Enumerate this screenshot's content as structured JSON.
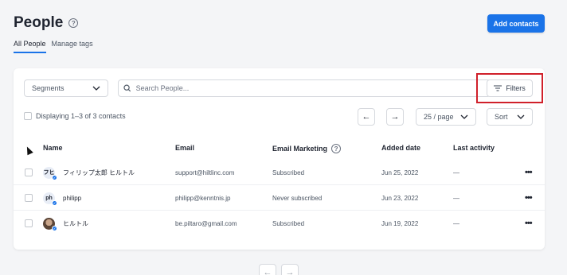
{
  "header": {
    "title": "People",
    "help_icon": "question-circle-icon",
    "add_button_label": "Add contacts",
    "accent": "#1a73e8"
  },
  "tabs": [
    {
      "label": "All People",
      "active": true
    },
    {
      "label": "Manage tags",
      "active": false
    }
  ],
  "toolbar": {
    "segments_label": "Segments",
    "search_placeholder": "Search People...",
    "filters_label": "Filters",
    "highlight_color": "#d0202a"
  },
  "listing": {
    "display_text": "Displaying 1–3 of 3 contacts",
    "prev_icon": "arrow-left-icon",
    "next_icon": "arrow-right-icon",
    "per_page": "25 / page",
    "sort_label": "Sort"
  },
  "table": {
    "columns": {
      "name": "Name",
      "email": "Email",
      "email_marketing": "Email Marketing",
      "added_date": "Added date",
      "last_activity": "Last activity"
    },
    "rows": [
      {
        "avatar_text": "フヒ",
        "name": "フィリップ太郎 ヒルトル",
        "email": "support@hiltlinc.com",
        "marketing": "Subscribed",
        "added": "Jun 25, 2022",
        "last_activity": "—"
      },
      {
        "avatar_text": "ph",
        "name": "philipp",
        "email": "philipp@kenntnis.jp",
        "marketing": "Never subscribed",
        "added": "Jun 23, 2022",
        "last_activity": "—"
      },
      {
        "avatar_text": "",
        "name": "ヒルトル",
        "email": "be.piltaro@gmail.com",
        "marketing": "Subscribed",
        "added": "Jun 19, 2022",
        "last_activity": "—"
      }
    ]
  },
  "pagination": {
    "prev_icon": "arrow-left-icon",
    "next_icon": "arrow-right-icon"
  }
}
